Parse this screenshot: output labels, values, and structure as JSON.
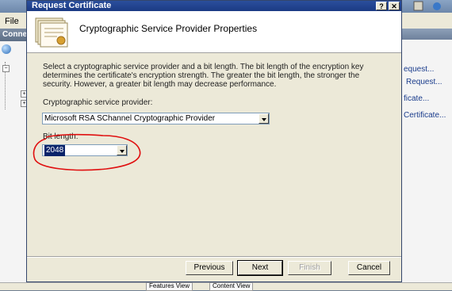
{
  "background_window": {
    "menu_file": "File",
    "connections_label": "Conne",
    "actions": [
      "equest...",
      "Request...",
      "ficate...",
      "Certificate..."
    ],
    "bottom_tabs": [
      "Features View",
      "Content View"
    ]
  },
  "dialog": {
    "title": "Request Certificate",
    "help_button": "?",
    "close_button": "✕",
    "header_title": "Cryptographic Service Provider Properties",
    "description": "Select a cryptographic service provider and a bit length. The bit length of the encryption key determines the certificate's encryption strength. The greater the bit length, the stronger the security. However, a greater bit length may decrease performance.",
    "provider_label": "Cryptographic service provider:",
    "provider_value": "Microsoft RSA SChannel Cryptographic Provider",
    "bitlength_label": "Bit length:",
    "bitlength_value": "2048",
    "buttons": {
      "previous": "Previous",
      "next": "Next",
      "finish": "Finish",
      "cancel": "Cancel"
    }
  },
  "colors": {
    "titlebar": "#1b3a84",
    "dialog_bg": "#ece9d8",
    "selection": "#0a246a",
    "annotation": "#e01010"
  }
}
